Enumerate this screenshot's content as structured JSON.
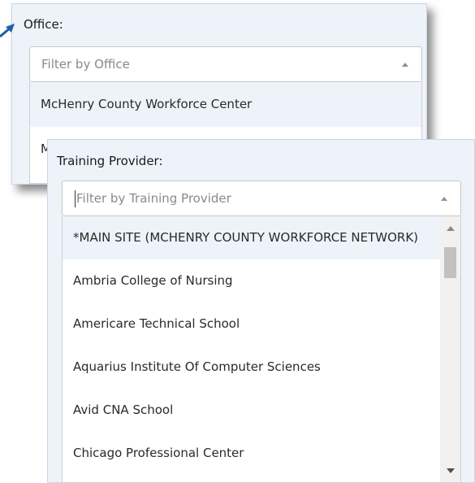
{
  "office": {
    "label": "Office:",
    "placeholder": "Filter by Office",
    "items": [
      "McHenry County Workforce Center",
      "McHenry County Workforce Network"
    ]
  },
  "training_provider": {
    "label": "Training Provider:",
    "placeholder": "Filter by Training Provider",
    "items": [
      "*MAIN SITE (MCHENRY COUNTY WORKFORCE NETWORK)",
      "Ambria College of Nursing",
      "Americare Technical School",
      "Aquarius Institute Of Computer Sciences",
      "Avid CNA School",
      "Chicago Professional Center"
    ]
  },
  "colors": {
    "panel_bg": "#edf3f9",
    "highlight_bg": "#edf3f9",
    "arrow": "#1f5fa8"
  },
  "icons": [
    "arrow-pointer-icon",
    "caret-up-icon",
    "scroll-up-icon",
    "scroll-down-icon"
  ]
}
